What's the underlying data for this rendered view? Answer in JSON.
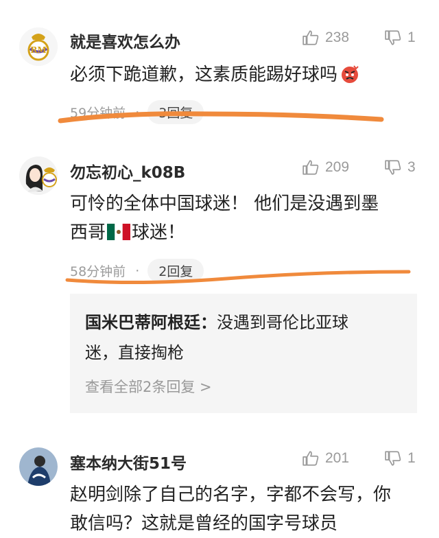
{
  "comments": [
    {
      "username": "就是喜欢怎么办",
      "likes": "238",
      "dislikes": "1",
      "text": "必须下跪道歉，这素质能踢好球吗",
      "time": "59分钟前",
      "reply_count": "3回复"
    },
    {
      "username": "勿忘初心_k08B",
      "likes": "209",
      "dislikes": "3",
      "text_line1": "可怜的全体中国球迷！ 他们是没遇到墨",
      "text_line2_a": "西哥",
      "text_line2_b": "球迷！",
      "time": "58分钟前",
      "reply_count": "2回复",
      "reply": {
        "author": "国米巴蒂阿根廷：",
        "text_a": "没遇到哥伦比亚球",
        "text_b": "迷，直接掏枪",
        "view_all": "查看全部2条回复 >"
      }
    },
    {
      "username": "塞本纳大街51号",
      "likes": "201",
      "dislikes": "1",
      "text_line1": "赵明剑除了自己的名字，字都不会写，你",
      "text_line2": "敢信吗？这就是曾经的国字号球员"
    }
  ],
  "colors": {
    "annotation": "#f08a3c",
    "muted": "#9a9a9a",
    "reply_bg": "#f5f5f5"
  }
}
